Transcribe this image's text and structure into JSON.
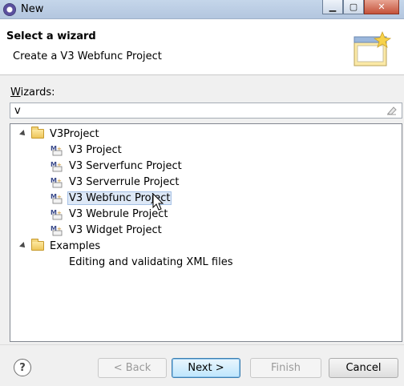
{
  "window": {
    "title": "New"
  },
  "header": {
    "title": "Select a wizard",
    "description": "Create a V3 Webfunc Project"
  },
  "wizards_label_prefix": "W",
  "wizards_label_rest": "izards:",
  "filter": {
    "value": "v"
  },
  "tree": {
    "v3project": {
      "label": "V3Project",
      "items": [
        {
          "label": "V3 Project"
        },
        {
          "label": "V3 Serverfunc Project"
        },
        {
          "label": "V3 Serverrule Project"
        },
        {
          "label": "V3 Webfunc Project"
        },
        {
          "label": "V3 Webrule Project"
        },
        {
          "label": "V3 Widget Project"
        }
      ]
    },
    "examples": {
      "label": "Examples",
      "items": [
        {
          "label": "Editing and validating XML files"
        }
      ]
    }
  },
  "buttons": {
    "help": "?",
    "back": "< Back",
    "next": "Next >",
    "finish": "Finish",
    "cancel": "Cancel"
  }
}
